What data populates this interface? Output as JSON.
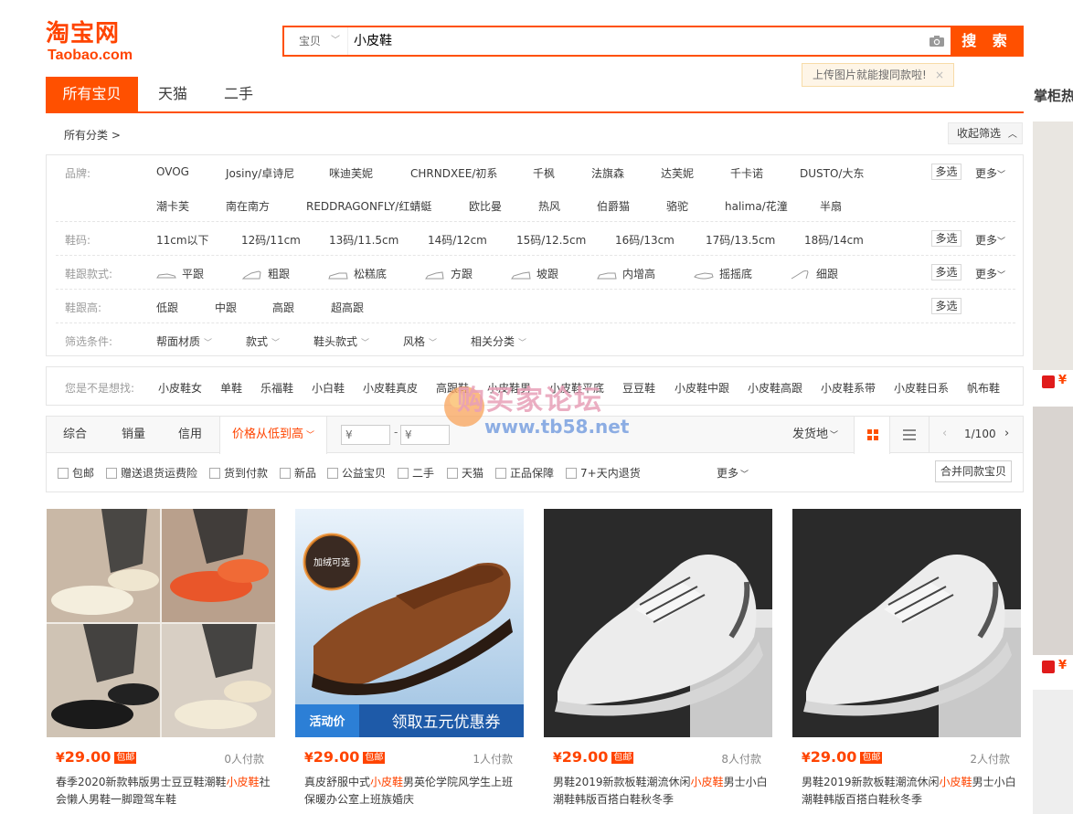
{
  "logo": {
    "cn": "淘宝网",
    "en": "Taobao.com"
  },
  "search": {
    "scope": "宝贝",
    "query": "小皮鞋",
    "button": "搜 索",
    "tip": "上传图片就能搜同款啦!",
    "tip_close": "×"
  },
  "tabs": [
    "所有宝贝",
    "天猫",
    "二手"
  ],
  "side_title": "掌柜热卖",
  "crumb": "所有分类 >",
  "collapse": "收起筛选",
  "filters": {
    "brand_label": "品牌:",
    "brands_row1": [
      "OVOG",
      "Josiny/卓诗尼",
      "咪迪芙妮",
      "CHRNDXEE/初系",
      "千枫",
      "法旗森",
      "达芙妮",
      "千卡诺",
      "DUSTO/大东"
    ],
    "brands_row2": [
      "潮卡芙",
      "南在南方",
      "REDDRAGONFLY/红蜻蜓",
      "欧比曼",
      "热风",
      "伯爵猫",
      "骆驼",
      "halima/花潼",
      "半扇"
    ],
    "size_label": "鞋码:",
    "sizes": [
      "11cm以下",
      "12码/11cm",
      "13码/11.5cm",
      "14码/12cm",
      "15码/12.5cm",
      "16码/13cm",
      "17码/13.5cm",
      "18码/14cm"
    ],
    "heel_style_label": "鞋跟款式:",
    "heel_styles": [
      "平跟",
      "粗跟",
      "松糕底",
      "方跟",
      "坡跟",
      "内增高",
      "摇摇底",
      "细跟"
    ],
    "heel_height_label": "鞋跟高:",
    "heel_heights": [
      "低跟",
      "中跟",
      "高跟",
      "超高跟"
    ],
    "cond_label": "筛选条件:",
    "conds": [
      "帮面材质",
      "款式",
      "鞋头款式",
      "风格",
      "相关分类"
    ],
    "multi": "多选",
    "more": "更多"
  },
  "suggest": {
    "label": "您是不是想找:",
    "items": [
      "小皮鞋女",
      "单鞋",
      "乐福鞋",
      "小白鞋",
      "小皮鞋真皮",
      "高跟鞋",
      "小皮鞋男",
      "小皮鞋平底",
      "豆豆鞋",
      "小皮鞋中跟",
      "小皮鞋高跟",
      "小皮鞋系带",
      "小皮鞋日系",
      "帆布鞋"
    ]
  },
  "sort": {
    "items": [
      "综合",
      "销量",
      "信用",
      "价格从低到高"
    ],
    "price_from": "¥",
    "price_to": "¥",
    "ship": "发货地",
    "page": "1/100",
    "checks": [
      "包邮",
      "赠送退货运费险",
      "货到付款",
      "新品",
      "公益宝贝",
      "二手",
      "天猫",
      "正品保障",
      "7+天内退货"
    ],
    "more": "更多",
    "merge": "合并同款宝贝"
  },
  "watermark": {
    "cn": "购买家论坛",
    "url": "www.tb58.net"
  },
  "products": [
    {
      "price": "29.00",
      "yen": "¥",
      "tag": "包邮",
      "deals": "0人付款",
      "title_pre": "春季2020新款韩版男士豆豆鞋潮鞋",
      "title_hl": "小皮鞋",
      "title_post": "社会懒人男鞋一脚蹬驾车鞋"
    },
    {
      "price": "29.00",
      "yen": "¥",
      "tag": "包邮",
      "deals": "1人付款",
      "title_pre": "真皮舒服中式",
      "title_hl": "小皮鞋",
      "title_post": "男英伦学院风学生上班保暖办公室上班族婚庆",
      "badge": "加绒可选",
      "banner_left": "活动价",
      "banner_right": "领取五元优惠券"
    },
    {
      "price": "29.00",
      "yen": "¥",
      "tag": "包邮",
      "deals": "8人付款",
      "title_pre": "男鞋2019新款板鞋潮流休闲",
      "title_hl": "小皮鞋",
      "title_post": "男士小白潮鞋韩版百搭白鞋秋冬季"
    },
    {
      "price": "29.00",
      "yen": "¥",
      "tag": "包邮",
      "deals": "2人付款",
      "title_pre": "男鞋2019新款板鞋潮流休闲",
      "title_hl": "小皮鞋",
      "title_post": "男士小白潮鞋韩版百搭白鞋秋冬季"
    }
  ],
  "colors": {
    "accent": "#ff5000",
    "price": "#ff4400"
  }
}
